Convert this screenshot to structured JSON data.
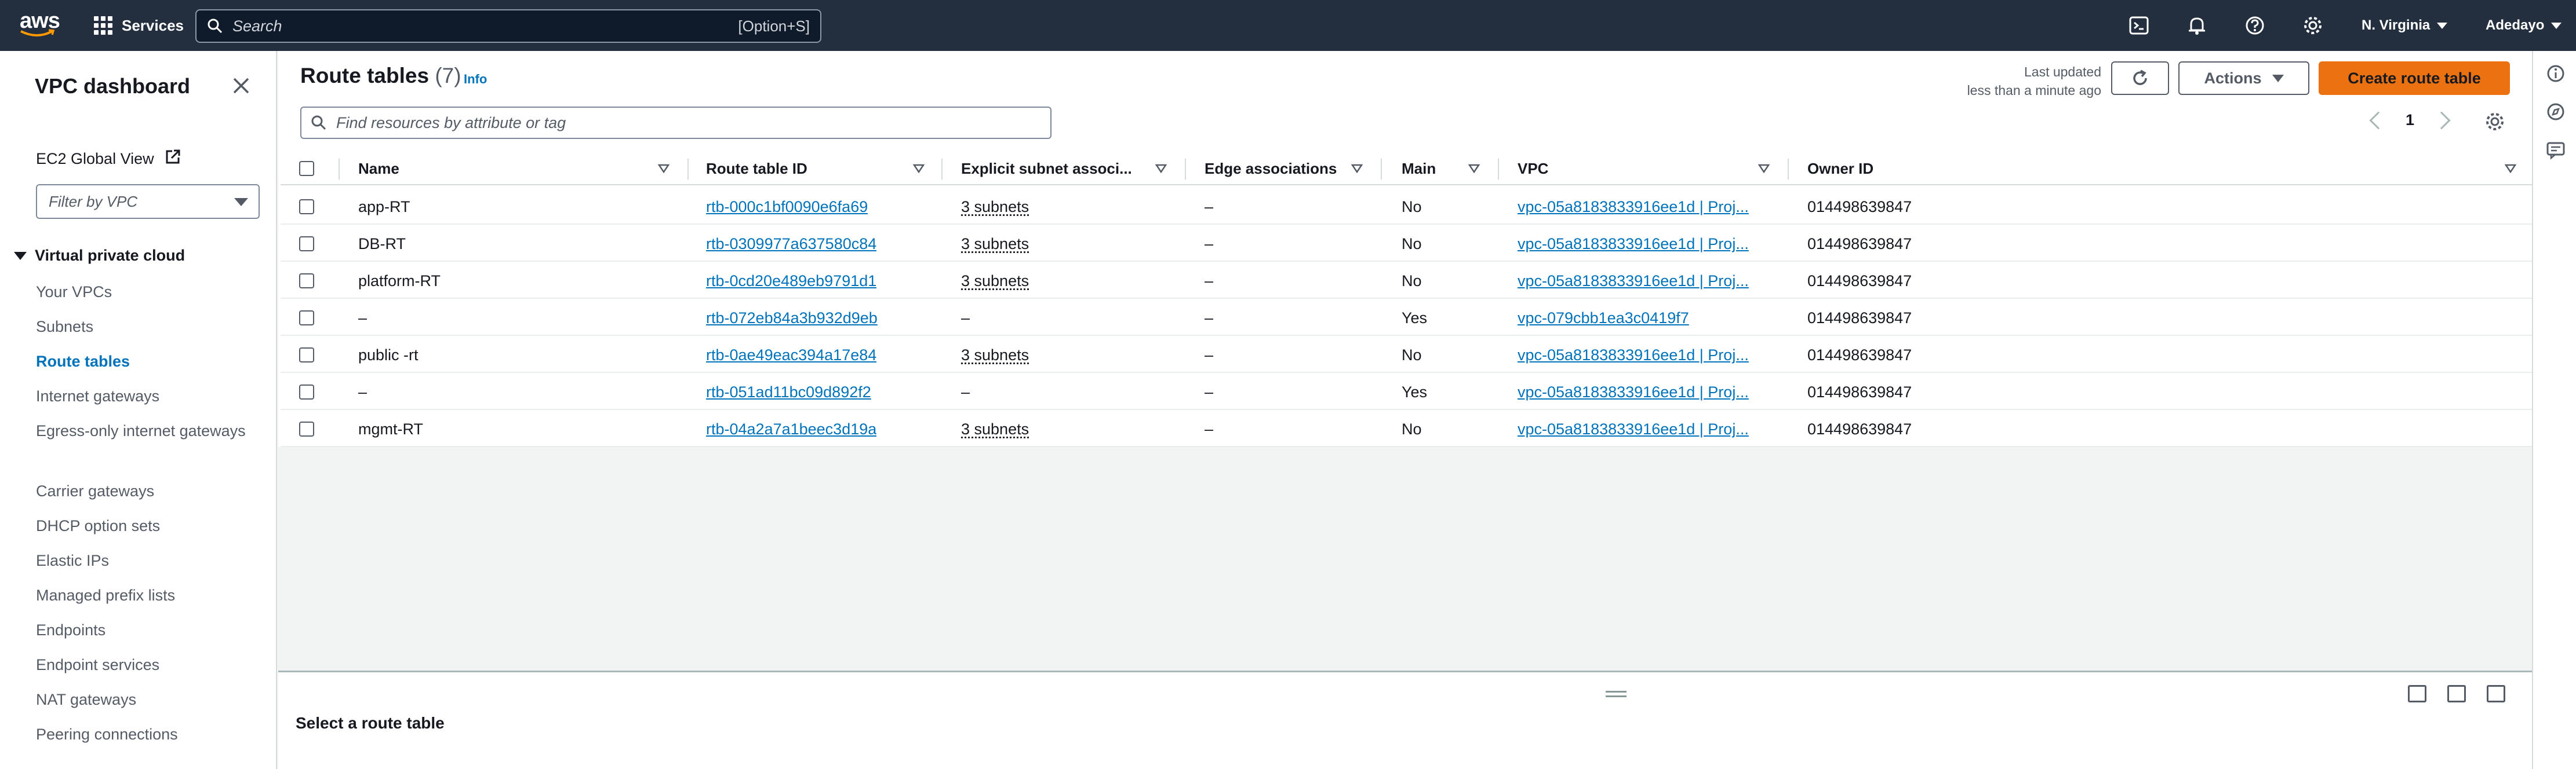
{
  "topnav": {
    "logo_text": "aws",
    "services_label": "Services",
    "search_placeholder": "Search",
    "search_shortcut": "[Option+S]",
    "region": "N. Virginia",
    "user": "Adedayo"
  },
  "sidebar": {
    "title": "VPC dashboard",
    "global_view": "EC2 Global View",
    "filter_placeholder": "Filter by VPC",
    "section": "Virtual private cloud",
    "items": [
      {
        "label": "Your VPCs",
        "active": false
      },
      {
        "label": "Subnets",
        "active": false
      },
      {
        "label": "Route tables",
        "active": true
      },
      {
        "label": "Internet gateways",
        "active": false
      },
      {
        "label": "Egress-only internet gateways",
        "active": false
      },
      {
        "label": "Carrier gateways",
        "active": false
      },
      {
        "label": "DHCP option sets",
        "active": false
      },
      {
        "label": "Elastic IPs",
        "active": false
      },
      {
        "label": "Managed prefix lists",
        "active": false
      },
      {
        "label": "Endpoints",
        "active": false
      },
      {
        "label": "Endpoint services",
        "active": false
      },
      {
        "label": "NAT gateways",
        "active": false
      },
      {
        "label": "Peering connections",
        "active": false
      }
    ]
  },
  "main": {
    "title": "Route tables",
    "count": "(7)",
    "info": "Info",
    "last_updated_label": "Last updated",
    "last_updated_value": "less than a minute ago",
    "actions_label": "Actions",
    "create_label": "Create route table",
    "filter_placeholder": "Find resources by attribute or tag",
    "page": "1"
  },
  "table": {
    "columns": [
      "Name",
      "Route table ID",
      "Explicit subnet associ...",
      "Edge associations",
      "Main",
      "VPC",
      "Owner ID"
    ],
    "rows": [
      {
        "name": "app-RT",
        "id": "rtb-000c1bf0090e6fa69",
        "subnets": "3 subnets",
        "edge": "–",
        "main": "No",
        "vpc": "vpc-05a8183833916ee1d | Proj...",
        "owner": "014498639847"
      },
      {
        "name": "DB-RT",
        "id": "rtb-0309977a637580c84",
        "subnets": "3 subnets",
        "edge": "–",
        "main": "No",
        "vpc": "vpc-05a8183833916ee1d | Proj...",
        "owner": "014498639847"
      },
      {
        "name": "platform-RT",
        "id": "rtb-0cd20e489eb9791d1",
        "subnets": "3 subnets",
        "edge": "–",
        "main": "No",
        "vpc": "vpc-05a8183833916ee1d | Proj...",
        "owner": "014498639847"
      },
      {
        "name": "–",
        "id": "rtb-072eb84a3b932d9eb",
        "subnets": "–",
        "edge": "–",
        "main": "Yes",
        "vpc": "vpc-079cbb1ea3c0419f7",
        "owner": "014498639847"
      },
      {
        "name": "public -rt",
        "id": "rtb-0ae49eac394a17e84",
        "subnets": "3 subnets",
        "edge": "–",
        "main": "No",
        "vpc": "vpc-05a8183833916ee1d | Proj...",
        "owner": "014498639847"
      },
      {
        "name": "–",
        "id": "rtb-051ad11bc09d892f2",
        "subnets": "–",
        "edge": "–",
        "main": "Yes",
        "vpc": "vpc-05a8183833916ee1d | Proj...",
        "owner": "014498639847"
      },
      {
        "name": "mgmt-RT",
        "id": "rtb-04a2a7a1beec3d19a",
        "subnets": "3 subnets",
        "edge": "–",
        "main": "No",
        "vpc": "vpc-05a8183833916ee1d | Proj...",
        "owner": "014498639847"
      }
    ]
  },
  "split_panel": {
    "title": "Select a route table"
  },
  "colors": {
    "nav_bg": "#232f3e",
    "link": "#0073bb",
    "primary_button": "#ec7211"
  }
}
